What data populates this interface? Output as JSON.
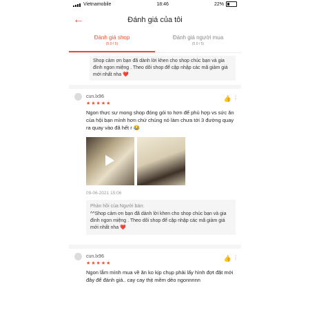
{
  "status": {
    "carrier": "Vietnamobile",
    "time": "18:46",
    "battery": "22%"
  },
  "header": {
    "title": "Đánh giá của tôi"
  },
  "tabs": [
    {
      "label": "Đánh giá shop",
      "sub": "(5.0 / 5)"
    },
    {
      "label": "Đánh giá người mua",
      "sub": "(5.0 / 5)"
    }
  ],
  "top_reply": "Shop cảm ơn bạn đã dành lời khen cho shop chúc bạn và gia đình ngon miệng . Theo dõi shop để cập nhập các mã giảm giá mới nhất nha ❤️",
  "reviews": [
    {
      "user": "cun.lx96",
      "stars": "★★★★★",
      "text": "Ngon thực sự mong shop đóng gói to hơn để phù hợp vs sức ăn của hội bạn mình hơn chứ chúng nó làm chưa tới 3 đường quay ra quay vào đã hết r 😂",
      "date": "09-06-2021 15:06",
      "reply_label": "Phản hồi của Người bán:",
      "reply": "^^Shop cảm ơn bạn đã dành lời khen cho shop chúc bạn và gia đình ngon miệng . Theo dõi shop để cập nhập các mã giảm giá mới nhất nha ❤️"
    },
    {
      "user": "cun.lx96",
      "stars": "★★★★★",
      "text": "Ngon lắm mình mua về ăn ko kịp chụp phải lấy hình đợt đặt mới đây để đánh giá.. cay cay thịt mềm dẻo ngonnnnn"
    }
  ],
  "icons": {
    "back": "back-arrow-icon",
    "like": "thumbs-up-icon",
    "more": "more-dots-icon",
    "play": "play-icon"
  }
}
